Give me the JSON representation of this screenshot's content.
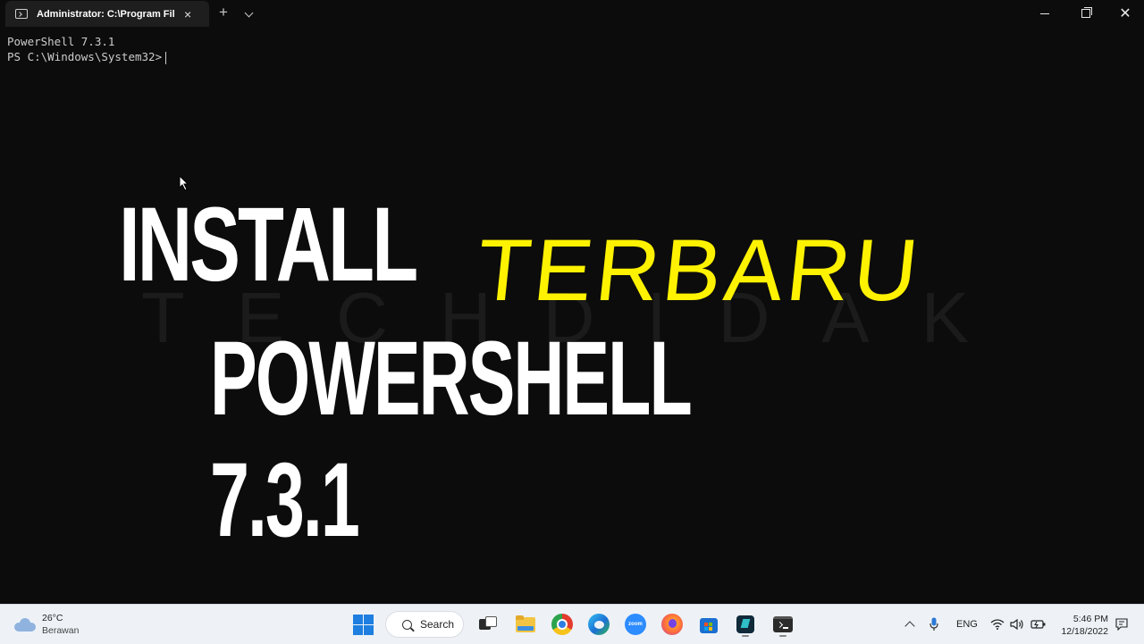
{
  "window": {
    "tab_title": "Administrator: C:\\Program Files",
    "tab_close": "×",
    "new_tab": "+",
    "close_glyph": "✕"
  },
  "console": {
    "line1": "PowerShell 7.3.1",
    "line2": "PS C:\\Windows\\System32>"
  },
  "overlay": {
    "install": "INSTALL",
    "terbaru": "TERBARU",
    "powershell": "POWERSHELL 7.3.1",
    "watermark": "TECHDIDAK"
  },
  "taskbar": {
    "weather_temp": "26°C",
    "weather_desc": "Berawan",
    "search_label": "Search",
    "apps": [
      "task-view-icon",
      "file-explorer-icon",
      "chrome-icon",
      "edge-icon",
      "zoom-icon",
      "firefox-icon",
      "store-icon",
      "editor-icon",
      "terminal-icon"
    ],
    "zoom_label": "zoom",
    "language": "ENG",
    "time": "5:46 PM",
    "date": "12/18/2022"
  },
  "colors": {
    "background": "#0c0c0c",
    "accent_yellow": "#fff200",
    "taskbar": "#eef2f7"
  }
}
